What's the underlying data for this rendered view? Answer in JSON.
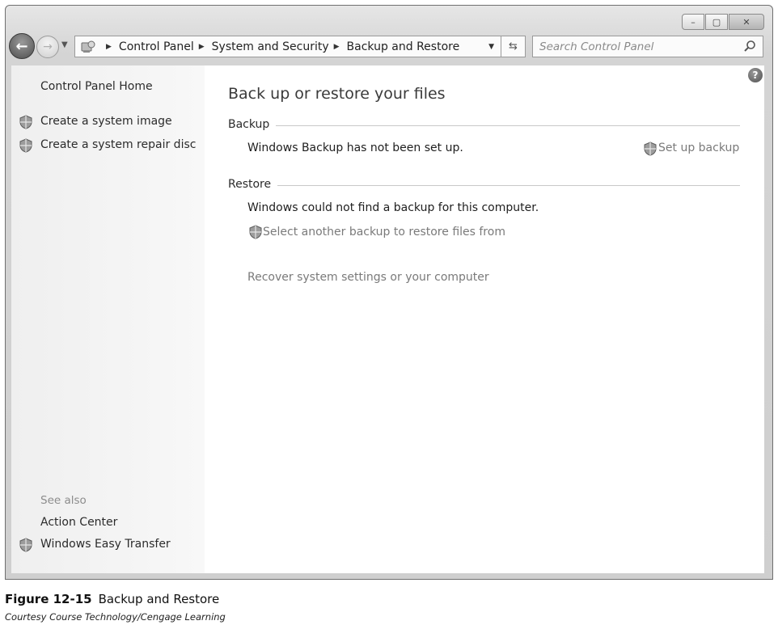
{
  "window": {
    "caption_buttons": {
      "minimize_glyph": "–",
      "maximize_glyph": "▢",
      "close_glyph": "✕"
    }
  },
  "navigation": {
    "back_glyph": "←",
    "forward_glyph": "→",
    "recent_glyph": "▼",
    "breadcrumbs": [
      "Control Panel",
      "System and Security",
      "Backup and Restore"
    ],
    "separator_glyph": "▶",
    "dropdown_glyph": "▼",
    "refresh_glyph": "⇆"
  },
  "search": {
    "placeholder": "Search Control Panel"
  },
  "sidebar": {
    "home_link": "Control Panel Home",
    "tasks": [
      "Create a system image",
      "Create a system repair disc"
    ],
    "see_also_label": "See also",
    "see_also": [
      "Action Center",
      "Windows Easy Transfer"
    ]
  },
  "main": {
    "help_glyph": "?",
    "title": "Back up or restore your files",
    "backup": {
      "heading": "Backup",
      "status": "Windows Backup has not been set up.",
      "action": "Set up backup"
    },
    "restore": {
      "heading": "Restore",
      "status": "Windows could not find a backup for this computer.",
      "select_action": "Select another backup to restore files from",
      "recover_link": "Recover system settings or your computer"
    }
  },
  "caption": {
    "figure_number": "Figure 12-15",
    "figure_title": "Backup and Restore",
    "credit": "Courtesy Course Technology/Cengage Learning"
  },
  "colors": {
    "link_text": "#7a7a7a",
    "body_text": "#1e1e1e",
    "sidebar_bg": "#efefef",
    "frame": "#d4d4d4"
  }
}
